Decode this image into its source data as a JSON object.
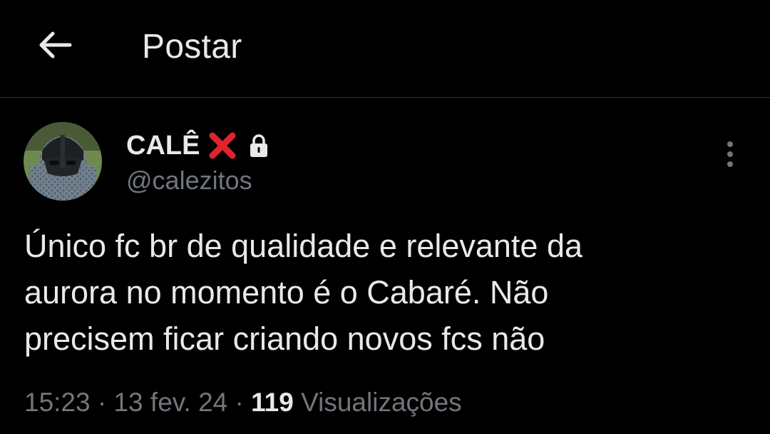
{
  "header": {
    "back_icon": "arrow-left-icon",
    "title": "Postar"
  },
  "author": {
    "display_name": "CALÊ",
    "badge_icon": "red-x-icon",
    "protected_icon": "lock-icon",
    "handle": "@calezitos"
  },
  "menu": {
    "icon": "more-vertical-icon"
  },
  "post": {
    "text": "Único fc br de qualidade e relevante da\naurora no momento é o Cabaré. Não\nprecisem ficar criando novos fcs não"
  },
  "meta": {
    "time": "15:23",
    "separator": "·",
    "date": "13 fev. 24",
    "views_count": "119",
    "views_label": "Visualizações"
  },
  "colors": {
    "background": "#000000",
    "text_primary": "#e7e9ea",
    "text_secondary": "#71767b",
    "divider": "#2f3336",
    "badge_red": "#e0242f"
  }
}
